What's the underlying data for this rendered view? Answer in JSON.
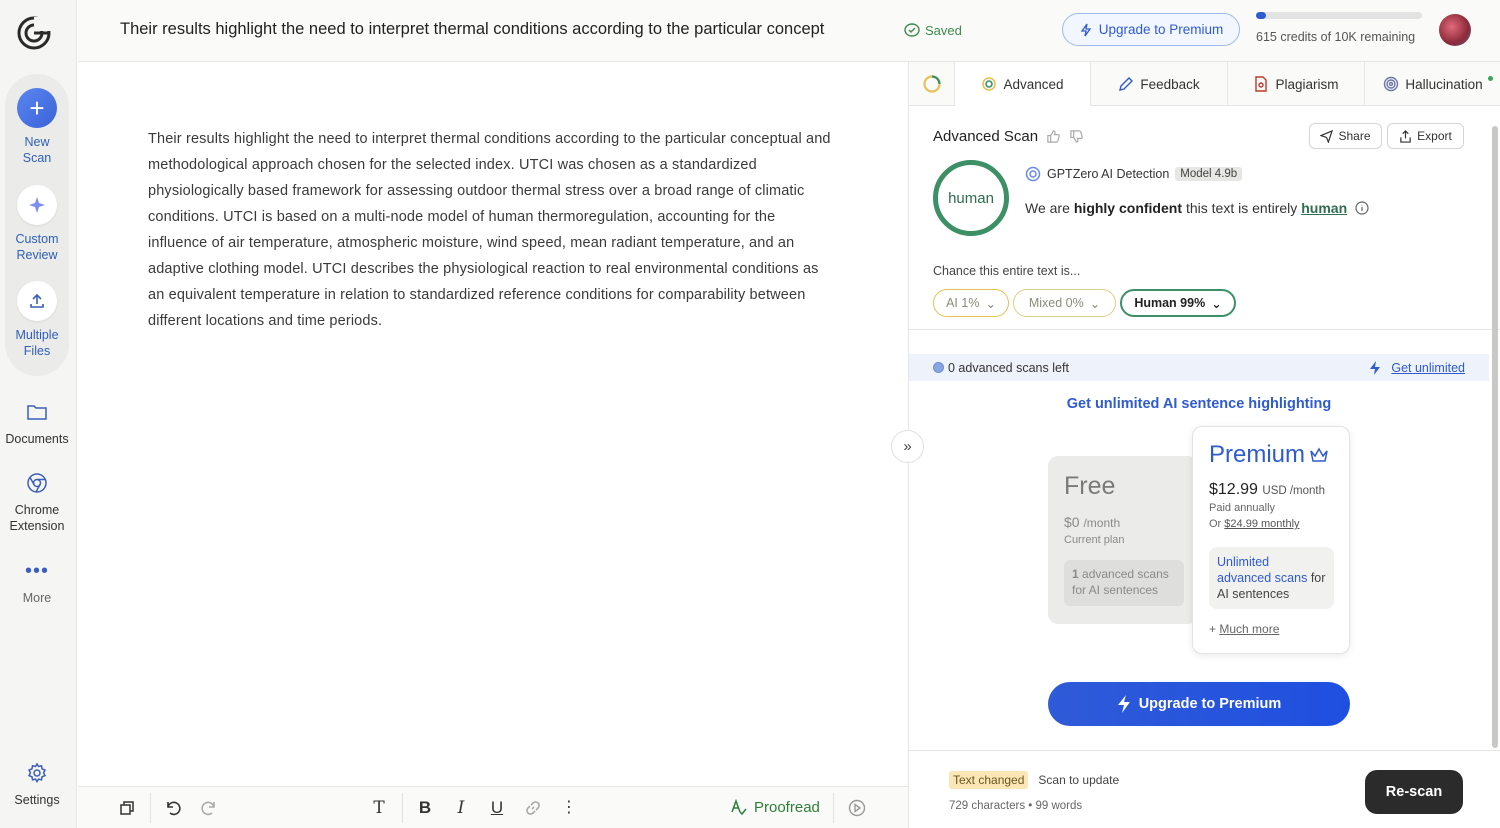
{
  "sidebar": {
    "new_scan": "New Scan",
    "custom_review": "Custom Review",
    "multiple_files": "Multiple Files",
    "documents": "Documents",
    "chrome_extension": "Chrome Extension",
    "more": "More",
    "settings": "Settings"
  },
  "topbar": {
    "title": "Their results highlight the need to interpret thermal conditions according to the particular concept",
    "saved": "Saved",
    "upgrade": "Upgrade to Premium",
    "credits_text": "615 credits of 10K remaining",
    "credits_fraction": 0.0615
  },
  "editor": {
    "text": "Their results highlight the need to interpret thermal conditions according to the particular conceptual and methodological approach chosen for the selected index. UTCI was chosen as a standardized physiologically based framework for assessing outdoor thermal stress over a broad range of climatic conditions. UTCI is based on a multi-node model of human thermoregulation, accounting for the influence of air temperature, atmospheric moisture, wind speed, mean radiant temperature, and an adaptive clothing model. UTCI describes the physiological reaction to real environmental conditions as an equivalent temperature in relation to standardized reference conditions for comparability between different locations and time periods."
  },
  "toolbar": {
    "proofread": "Proofread"
  },
  "panel": {
    "tabs": [
      "Advanced",
      "Feedback",
      "Plagiarism",
      "Hallucination"
    ],
    "scan_title": "Advanced Scan",
    "share": "Share",
    "export": "Export",
    "gauge_label": "human",
    "detector": "GPTZero AI Detection",
    "model": "Model 4.9b",
    "verdict_pre": "We are",
    "verdict_bold": "highly confident",
    "verdict_mid": "this text is entirely",
    "verdict_result": "human",
    "chance_label": "Chance this entire text is...",
    "chips": {
      "ai": "AI 1%",
      "mixed": "Mixed 0%",
      "human": "Human 99%"
    },
    "scans_left": "0 advanced scans left",
    "get_unlimited": "Get unlimited",
    "headline": "Get unlimited AI sentence highlighting",
    "free": {
      "name": "Free",
      "price": "$0",
      "period": "/month",
      "current": "Current plan",
      "feature_count": "1",
      "feature_rest": "advanced scans for AI sentences"
    },
    "premium": {
      "name": "Premium",
      "price": "$12.99",
      "currency": "USD /month",
      "annual": "Paid annually",
      "or": "Or",
      "monthly": "$24.99 monthly",
      "feature_highlight": "Unlimited advanced scans",
      "feature_rest": "for AI sentences",
      "more_prefix": "+",
      "more": "Much more"
    },
    "upgrade_big": "Upgrade to Premium",
    "text_changed": "Text changed",
    "scan_to_update": "Scan to update",
    "counts": "729 characters • 99 words",
    "rescan": "Re-scan"
  },
  "colors": {
    "accent": "#2f5bd0",
    "human_green": "#3d8f66",
    "ai_yellow": "#e6c155"
  }
}
